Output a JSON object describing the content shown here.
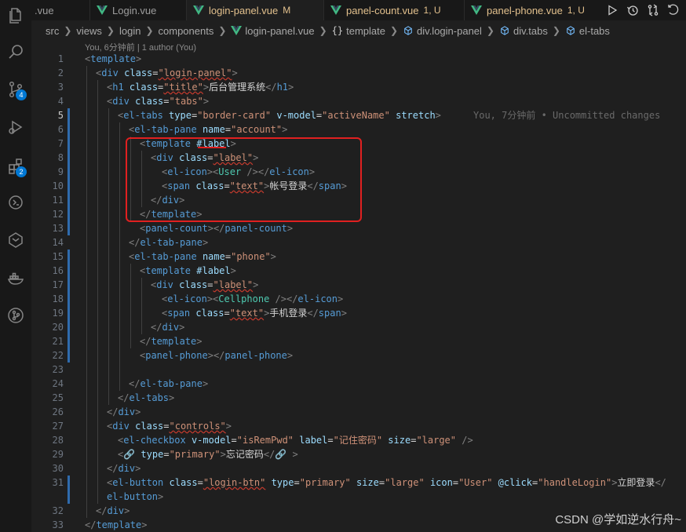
{
  "tabs": [
    {
      "label": ".vue",
      "status": "",
      "kind": "plain"
    },
    {
      "label": "Login.vue",
      "status": "",
      "kind": "plain"
    },
    {
      "label": "login-panel.vue",
      "status": "M",
      "kind": "active"
    },
    {
      "label": "panel-count.vue",
      "status": "1, U",
      "kind": "mod"
    },
    {
      "label": "panel-phone.vue",
      "status": "1, U",
      "kind": "mod"
    }
  ],
  "breadcrumb": [
    "src",
    "views",
    "login",
    "components",
    "login-panel.vue",
    "template",
    "div.login-panel",
    "div.tabs",
    "el-tabs"
  ],
  "blame": "You, 6分钟前 | 1 author (You)",
  "ghost": "You, 7分钟前 • Uncommitted changes",
  "watermark": "CSDN @学如逆水行舟~",
  "badges": {
    "source_control": "4",
    "extensions": "2"
  },
  "line_numbers": [
    "1",
    "2",
    "3",
    "4",
    "5",
    "6",
    "7",
    "8",
    "9",
    "10",
    "11",
    "12",
    "13",
    "14",
    "15",
    "16",
    "17",
    "18",
    "19",
    "20",
    "21",
    "22",
    "23",
    "24",
    "25",
    "26",
    "27",
    "28",
    "29",
    "30",
    "31",
    "",
    "32",
    "33"
  ],
  "code": {
    "l1_tag": "template",
    "l2_tag": "div",
    "l2_attr": "class",
    "l2_val": "\"login-panel\"",
    "l3_tag": "h1",
    "l3_attr": "class",
    "l3_val": "\"title\"",
    "l3_text": "后台管理系统",
    "l3_close": "h1",
    "l4_tag": "div",
    "l4_attr": "class",
    "l4_val": "\"tabs\"",
    "l5_tag": "el-tabs",
    "l5_a1": "type",
    "l5_v1": "\"border-card\"",
    "l5_a2": "v-model",
    "l5_v2": "\"activeName\"",
    "l5_a3": "stretch",
    "l6_tag": "el-tab-pane",
    "l6_attr": "name",
    "l6_val": "\"account\"",
    "l7_tag": "template",
    "l7_slot": "#label",
    "l8_tag": "div",
    "l8_attr": "class",
    "l8_val": "\"label\"",
    "l9_tag": "el-icon",
    "l9_comp": "User",
    "l9_close": "el-icon",
    "l10_tag": "span",
    "l10_attr": "class",
    "l10_val": "\"text\"",
    "l10_text": "帐号登录",
    "l10_close": "span",
    "l11_close": "div",
    "l12_close": "template",
    "l13_tag": "panel-count",
    "l13_close": "panel-count",
    "l14_close": "el-tab-pane",
    "l15_tag": "el-tab-pane",
    "l15_attr": "name",
    "l15_val": "\"phone\"",
    "l16_tag": "template",
    "l16_slot": "#label",
    "l17_tag": "div",
    "l17_attr": "class",
    "l17_val": "\"label\"",
    "l18_tag": "el-icon",
    "l18_comp": "Cellphone",
    "l18_close": "el-icon",
    "l19_tag": "span",
    "l19_attr": "class",
    "l19_val": "\"text\"",
    "l19_text": "手机登录",
    "l19_close": "span",
    "l20_close": "div",
    "l21_close": "template",
    "l22_tag": "panel-phone",
    "l22_close": "panel-phone",
    "l24_close": "el-tab-pane",
    "l25_close": "el-tabs",
    "l26_close": "div",
    "l27_tag": "div",
    "l27_attr": "class",
    "l27_val": "\"controls\"",
    "l28_tag": "el-checkbox",
    "l28_a1": "v-model",
    "l28_v1": "\"isRemPwd\"",
    "l28_a2": "label",
    "l28_v2": "\"记住密码\"",
    "l28_a3": "size",
    "l28_v3": "\"large\"",
    "l29_attr": "type",
    "l29_val": "\"primary\"",
    "l29_text": "忘记密码",
    "l30_close": "div",
    "l31_tag": "el-button",
    "l31_a1": "class",
    "l31_v1": "\"login-btn\"",
    "l31_a2": "type",
    "l31_v2": "\"primary\"",
    "l31_a3": "size",
    "l31_v3": "\"large\"",
    "l31_a4": "icon",
    "l31_v4": "\"User\"",
    "l31_a5": "@click",
    "l31_v5": "\"handleLogin\"",
    "l31_text": "立即登录",
    "l31_close": "el-button",
    "l32_close": "div",
    "l33_close": "template"
  }
}
